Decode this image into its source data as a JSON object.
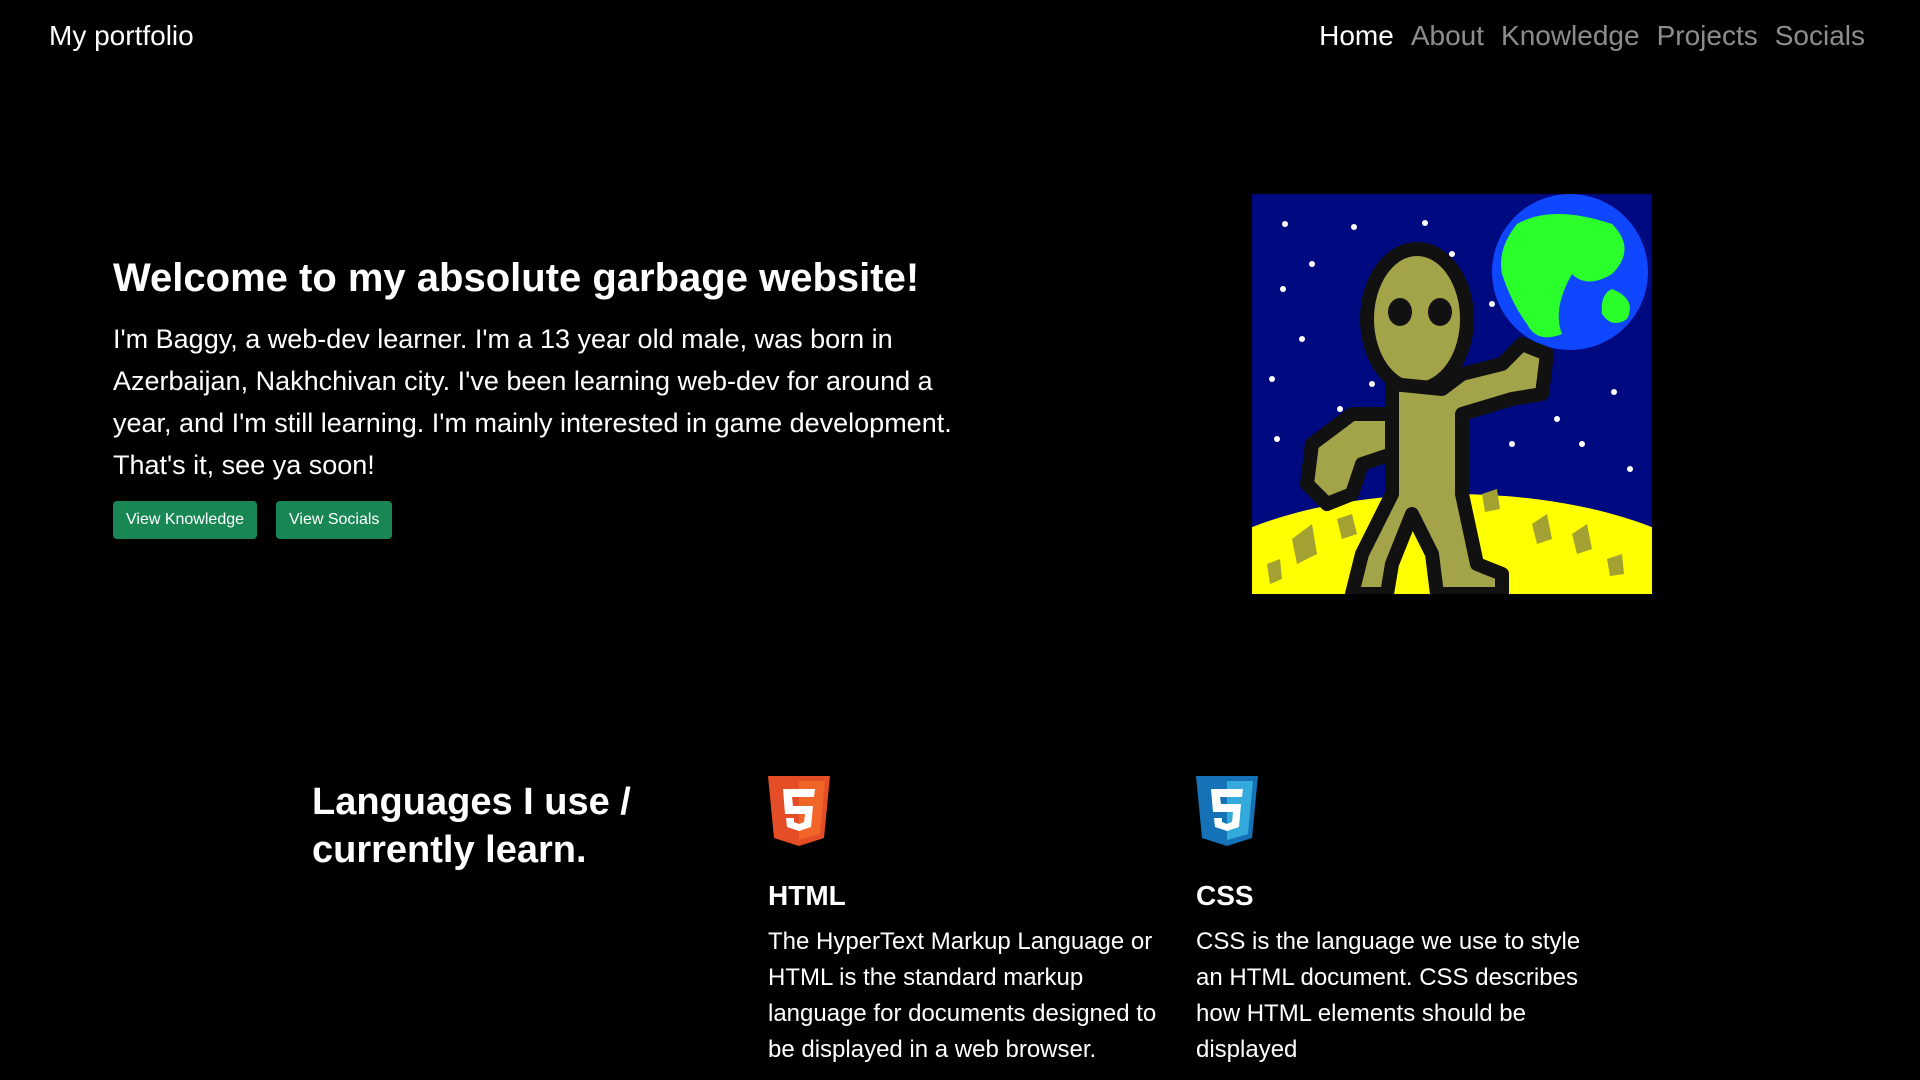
{
  "navbar": {
    "brand": "My portfolio",
    "links": [
      {
        "label": "Home",
        "active": true
      },
      {
        "label": "About"
      },
      {
        "label": "Knowledge"
      },
      {
        "label": "Projects"
      },
      {
        "label": "Socials"
      }
    ]
  },
  "hero": {
    "title": "Welcome to my absolute garbage website!",
    "text": "I'm Baggy, a web-dev learner. I'm a 13 year old male, was born in Azerbaijan, Nakhchivan city. I've been learning web-dev for around a year, and I'm still learning. I'm mainly interested in game development. That's it, see ya soon!",
    "buttons": {
      "knowledge": "View Knowledge",
      "socials": "View Socials"
    },
    "image": "alien-on-moon-drawing"
  },
  "languages": {
    "title": "Languages I use / currently learn.",
    "items": [
      {
        "name": "HTML",
        "icon": "html5-icon",
        "description": "The HyperText Markup Language or HTML is the standard markup language for documents designed to be displayed in a web browser."
      },
      {
        "name": "CSS",
        "icon": "css3-icon",
        "description": "CSS is the language we use to style an HTML document. CSS describes how HTML elements should be displayed"
      }
    ]
  },
  "colors": {
    "background": "#000000",
    "button": "#198754",
    "html_orange": "#E44D26",
    "css_blue": "#1572B6"
  }
}
